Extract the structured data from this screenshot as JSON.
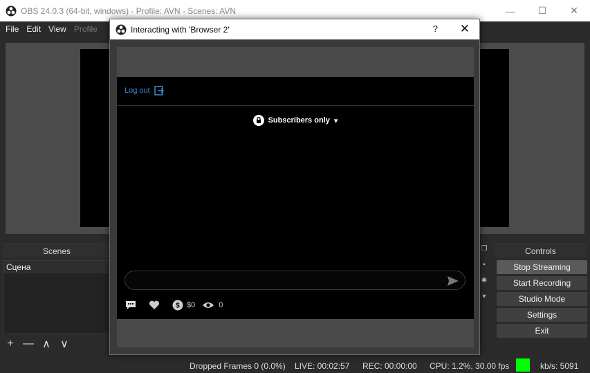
{
  "window": {
    "title": "OBS 24.0.3 (64-bit, windows) - Profile: AVN - Scenes: AVN",
    "minimize": "—",
    "maximize": "☐",
    "close": "✕"
  },
  "menu": {
    "file": "File",
    "edit": "Edit",
    "view": "View",
    "profile": "Profile"
  },
  "scenes": {
    "header": "Scenes",
    "items": [
      "Сцена"
    ],
    "toolbar": {
      "add": "+",
      "remove": "—",
      "up": "∧",
      "down": "∨"
    }
  },
  "controls": {
    "header": "Controls",
    "stop_streaming": "Stop Streaming",
    "start_recording": "Start Recording",
    "studio_mode": "Studio Mode",
    "settings": "Settings",
    "exit": "Exit"
  },
  "status": {
    "dropped_frames": "Dropped Frames 0 (0.0%)",
    "live": "LIVE: 00:02:57",
    "rec": "REC: 00:00:00",
    "cpu": "CPU: 1.2%, 30.00 fps",
    "kbs": "kb/s: 5091",
    "indicator_color": "#00ff00"
  },
  "dialog": {
    "title": "Interacting with 'Browser 2'",
    "help": "?",
    "close": "✕",
    "page": {
      "logout": "Log out",
      "subscribers": "Subscribers only",
      "chat_placeholder": "",
      "tip_amount": "$0",
      "viewer_count": "0"
    }
  },
  "colors": {
    "link_blue": "#3f8bd8",
    "dark_bg": "#2b2b2b"
  }
}
